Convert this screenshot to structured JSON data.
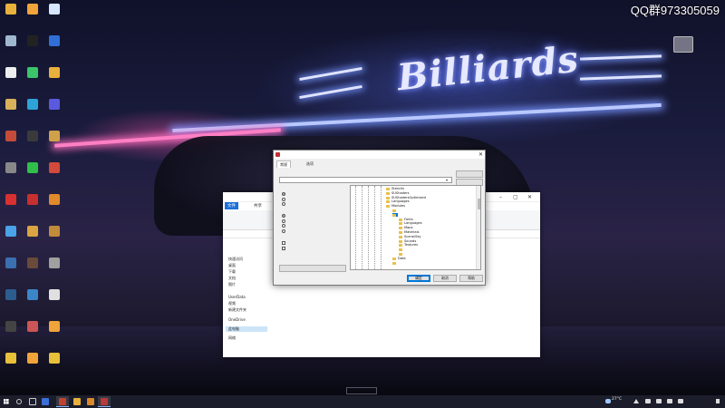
{
  "watermark": "QQ群973305059",
  "wallpaper": {
    "sign_text": "Billiards"
  },
  "desktop_icons": [
    {
      "label": "",
      "icon": "folder-icon",
      "color": "#e8b13c"
    },
    {
      "label": "",
      "icon": "app-icon",
      "color": "#f0a43a"
    },
    {
      "label": "",
      "icon": "app-icon",
      "color": "#d6e6ff"
    },
    {
      "label": "",
      "icon": "recycle-bin-icon",
      "color": "#9fb8d0"
    },
    {
      "label": "",
      "icon": "app-icon",
      "color": "#222222"
    },
    {
      "label": "",
      "icon": "app-icon",
      "color": "#2f6fd6"
    },
    {
      "label": "",
      "icon": "app-icon",
      "color": "#eeeeee"
    },
    {
      "label": "",
      "icon": "app-icon",
      "color": "#3cc46a"
    },
    {
      "label": "",
      "icon": "folder-icon",
      "color": "#e8b13c"
    },
    {
      "label": "",
      "icon": "app-icon",
      "color": "#d8b15a"
    },
    {
      "label": "",
      "icon": "app-icon",
      "color": "#2ea3d8"
    },
    {
      "label": "",
      "icon": "app-icon",
      "color": "#5a5adf"
    },
    {
      "label": "",
      "icon": "app-icon",
      "color": "#c44b3a"
    },
    {
      "label": "",
      "icon": "app-icon",
      "color": "#3a3a3a"
    },
    {
      "label": "",
      "icon": "app-icon",
      "color": "#cfa24a"
    },
    {
      "label": "",
      "icon": "app-icon",
      "color": "#888888"
    },
    {
      "label": "",
      "icon": "app-icon",
      "color": "#2fbf4a"
    },
    {
      "label": "",
      "icon": "app-icon",
      "color": "#d14a3a"
    },
    {
      "label": "",
      "icon": "app-icon",
      "color": "#d93030"
    },
    {
      "label": "",
      "icon": "app-icon",
      "color": "#c82f2f"
    },
    {
      "label": "",
      "icon": "app-icon",
      "color": "#e08a2a"
    },
    {
      "label": "",
      "icon": "app-icon",
      "color": "#4aa3e8"
    },
    {
      "label": "",
      "icon": "app-icon",
      "color": "#d9a441"
    },
    {
      "label": "",
      "icon": "app-icon",
      "color": "#c28b3a"
    },
    {
      "label": "",
      "icon": "app-icon",
      "color": "#3a6fb0"
    },
    {
      "label": "",
      "icon": "app-icon",
      "color": "#6a4a3a"
    },
    {
      "label": "",
      "icon": "app-icon",
      "color": "#a0a0a0"
    },
    {
      "label": "",
      "icon": "app-icon",
      "color": "#2c5d8f"
    },
    {
      "label": "",
      "icon": "app-icon",
      "color": "#3a86c8"
    },
    {
      "label": "",
      "icon": "app-icon",
      "color": "#e0e0e0"
    },
    {
      "label": "",
      "icon": "app-icon",
      "color": "#444444"
    },
    {
      "label": "",
      "icon": "app-icon",
      "color": "#cc5555"
    },
    {
      "label": "",
      "icon": "app-icon",
      "color": "#f0a43a"
    },
    {
      "label": "",
      "icon": "app-icon",
      "color": "#e8c03a"
    },
    {
      "label": "",
      "icon": "app-icon",
      "color": "#f0a43a"
    },
    {
      "label": "",
      "icon": "app-icon",
      "color": "#e8c03a"
    }
  ],
  "explorer": {
    "tabs": {
      "file": "文件",
      "home": "",
      "share": "共享",
      "view": ""
    },
    "nav": [
      {
        "label": "快速访问",
        "selected": false
      },
      {
        "label": "桌面",
        "selected": false
      },
      {
        "label": "下载",
        "selected": false
      },
      {
        "label": "文档",
        "selected": false
      },
      {
        "label": "图片",
        "selected": false
      },
      {
        "label": "",
        "selected": false
      },
      {
        "label": "UserData",
        "selected": false
      },
      {
        "label": "视频",
        "selected": false
      },
      {
        "label": "新建文件夹",
        "selected": false
      },
      {
        "label": "OneDrive",
        "selected": false
      },
      {
        "label": "此电脑",
        "selected": true
      },
      {
        "label": "网络",
        "selected": false
      }
    ],
    "status": ""
  },
  "dialog": {
    "title": "",
    "tabs": {
      "general": "常规",
      "advanced": "",
      "options": "选项"
    },
    "path_label": "",
    "path_value": "",
    "browse_button": "",
    "new_folder_button": "",
    "update_mode_label": "",
    "update_mode_options": [
      {
        "label": "",
        "checked": true
      },
      {
        "label": "",
        "checked": false
      },
      {
        "label": "",
        "checked": false
      }
    ],
    "overwrite_label": "",
    "overwrite_options": [
      {
        "label": "",
        "checked": true
      },
      {
        "label": "",
        "checked": false
      },
      {
        "label": "",
        "checked": false
      },
      {
        "label": "",
        "checked": false
      }
    ],
    "misc_label": "",
    "misc_options": [
      {
        "label": "",
        "checked": false
      },
      {
        "label": "",
        "checked": false
      }
    ],
    "save_settings_button": "",
    "tree": [
      {
        "label": "Stencils",
        "indent": 3,
        "selected": false
      },
      {
        "label": "SUShaders",
        "indent": 3,
        "selected": false
      },
      {
        "label": "SUShadersOptimized",
        "indent": 3,
        "selected": false
      },
      {
        "label": "Languages",
        "indent": 3,
        "selected": false
      },
      {
        "label": "Modules",
        "indent": 3,
        "selected": false
      },
      {
        "label": "",
        "indent": 4,
        "selected": false
      },
      {
        "label": "",
        "indent": 4,
        "selected": true
      },
      {
        "label": "Fonts",
        "indent": 5,
        "selected": false
      },
      {
        "label": "Languages",
        "indent": 5,
        "selected": false
      },
      {
        "label": "Maps",
        "indent": 5,
        "selected": false
      },
      {
        "label": "Materials",
        "indent": 5,
        "selected": false
      },
      {
        "label": "Scene/Sky",
        "indent": 5,
        "selected": false
      },
      {
        "label": "Sounds",
        "indent": 5,
        "selected": false
      },
      {
        "label": "Textures",
        "indent": 5,
        "selected": false
      },
      {
        "label": "",
        "indent": 5,
        "selected": false
      },
      {
        "label": "",
        "indent": 5,
        "selected": false
      },
      {
        "label": "Data",
        "indent": 4,
        "selected": false
      },
      {
        "label": "",
        "indent": 4,
        "selected": false
      }
    ],
    "ok_button": "确定",
    "cancel_button": "取消",
    "help_button": "帮助"
  },
  "taskbar": {
    "weather": "27°C",
    "time": "",
    "date": "",
    "center_label": ""
  }
}
